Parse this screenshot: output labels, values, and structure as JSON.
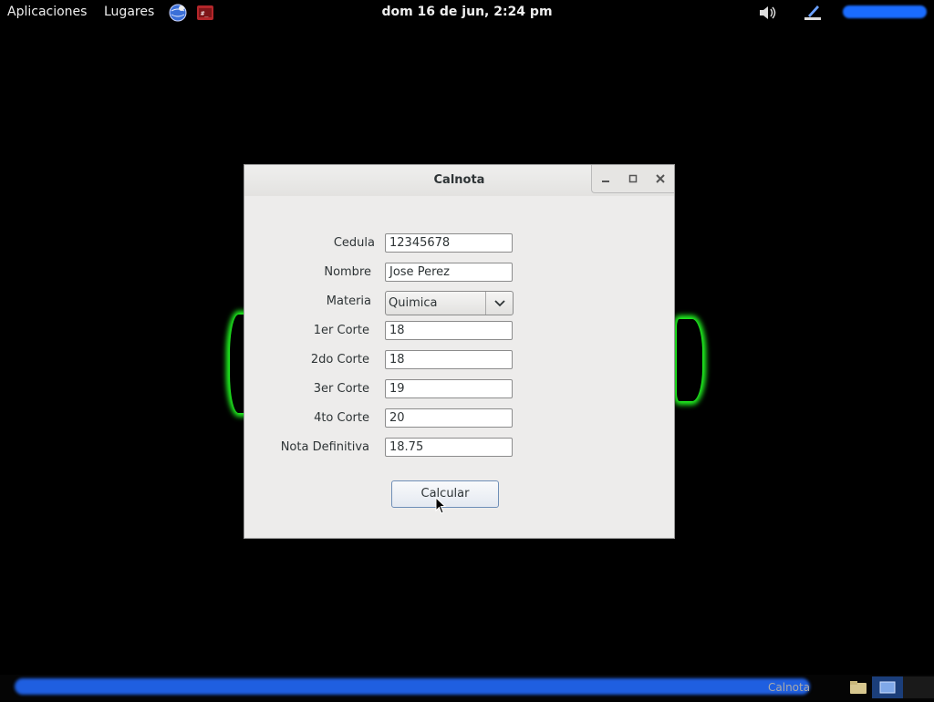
{
  "top_panel": {
    "applications": "Aplicaciones",
    "places": "Lugares",
    "clock": "dom 16 de jun,  2:24 pm",
    "icons": [
      "browser-globe-icon",
      "terminal-icon",
      "volume-icon",
      "pencil-network-icon"
    ]
  },
  "window": {
    "title": "Calnota",
    "form": {
      "cedula_label": "Cedula",
      "cedula_value": "12345678",
      "nombre_label": "Nombre",
      "nombre_value": "Jose Perez",
      "materia_label": "Materia",
      "materia_value": "Quimica",
      "corte1_label": "1er Corte",
      "corte1_value": "18",
      "corte2_label": "2do Corte",
      "corte2_value": "18",
      "corte3_label": "3er Corte",
      "corte3_value": "19",
      "corte4_label": "4to Corte",
      "corte4_value": "20",
      "nota_label": "Nota Definitiva",
      "nota_value": "18.75"
    },
    "calc_button": "Calcular"
  },
  "taskbar": {
    "active_item": "Calnota"
  },
  "colors": {
    "accent": "#1f5fe0",
    "glow": "#22ff22",
    "window_bg": "#edeceb"
  }
}
